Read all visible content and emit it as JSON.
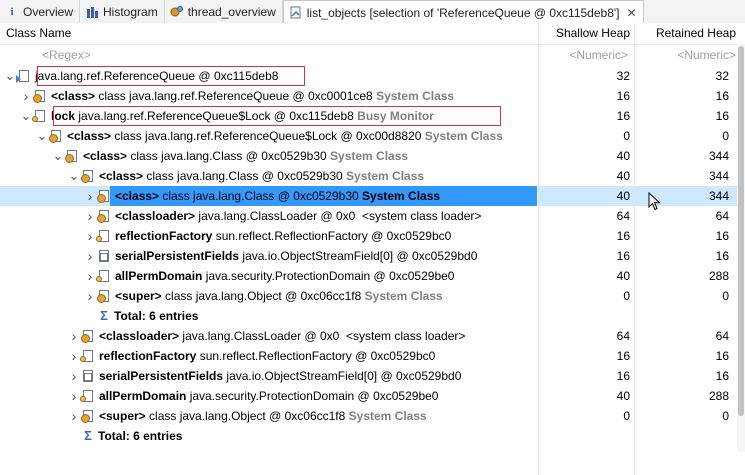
{
  "tabs": [
    {
      "label": "Overview",
      "icon": "info-icon"
    },
    {
      "label": "Histogram",
      "icon": "histogram-icon"
    },
    {
      "label": "thread_overview",
      "icon": "gears-icon"
    },
    {
      "label": "list_objects [selection of 'ReferenceQueue @ 0xc115deb8']",
      "icon": "list-objects-icon",
      "active": true
    }
  ],
  "columns": {
    "class_name": "Class Name",
    "shallow": "Shallow Heap",
    "retained": "Retained Heap"
  },
  "filters": {
    "class_name": "<Regex>",
    "shallow": "<Numeric>",
    "retained": "<Numeric>"
  },
  "rows": [
    {
      "arrow": "open",
      "icon": "object-page-icon",
      "parts": [
        [
          "",
          "java.lang.ref.ReferenceQueue @ 0xc115deb8"
        ]
      ],
      "shallow": "32",
      "retained": "32",
      "boxed": true
    },
    {
      "arrow": "closed",
      "icon": "class-gear-icon",
      "parts": [
        [
          "b",
          "<class>"
        ],
        [
          "",
          " class java.lang.ref.ReferenceQueue @ 0xc0001ce8 "
        ],
        [
          "gray",
          "System Class"
        ]
      ],
      "shallow": "16",
      "retained": "16"
    },
    {
      "arrow": "open",
      "icon": "field-page-icon",
      "parts": [
        [
          "b",
          "lock"
        ],
        [
          "",
          " java.lang.ref.ReferenceQueue$Lock @ 0xc115deb8 "
        ],
        [
          "gray",
          "Busy Monitor"
        ]
      ],
      "shallow": "16",
      "retained": "16",
      "boxed": true
    },
    {
      "arrow": "open",
      "icon": "class-gear-icon",
      "parts": [
        [
          "b",
          "<class>"
        ],
        [
          "",
          " class java.lang.ref.ReferenceQueue$Lock @ 0xc00d8820 "
        ],
        [
          "gray",
          "System Class"
        ]
      ],
      "shallow": "0",
      "retained": "0"
    },
    {
      "arrow": "open",
      "icon": "class-gear-icon",
      "parts": [
        [
          "b",
          "<class>"
        ],
        [
          "",
          " class java.lang.Class @ 0xc0529b30 "
        ],
        [
          "gray",
          "System Class"
        ]
      ],
      "shallow": "40",
      "retained": "344"
    },
    {
      "arrow": "open",
      "icon": "class-gear-icon",
      "parts": [
        [
          "b",
          "<class>"
        ],
        [
          "",
          " class java.lang.Class @ 0xc0529b30 "
        ],
        [
          "gray",
          "System Class"
        ]
      ],
      "shallow": "40",
      "retained": "344"
    },
    {
      "arrow": "closed",
      "icon": "class-gear-icon",
      "parts": [
        [
          "b",
          "<class>"
        ],
        [
          "",
          " class java.lang.Class @ 0xc0529b30 "
        ],
        [
          "b",
          "System Class"
        ]
      ],
      "shallow": "40",
      "retained": "344",
      "selected": true
    },
    {
      "arrow": "closed",
      "icon": "class-gear-icon",
      "parts": [
        [
          "b",
          "<classloader>"
        ],
        [
          "",
          " java.lang.ClassLoader @ 0x0  <system class loader>"
        ]
      ],
      "shallow": "64",
      "retained": "64"
    },
    {
      "arrow": "closed",
      "icon": "field-page-icon",
      "parts": [
        [
          "b",
          "reflectionFactory"
        ],
        [
          "",
          " sun.reflect.ReflectionFactory @ 0xc0529bc0"
        ]
      ],
      "shallow": "16",
      "retained": "16"
    },
    {
      "arrow": "closed",
      "icon": "array-page-icon",
      "parts": [
        [
          "b",
          "serialPersistentFields"
        ],
        [
          "",
          " java.io.ObjectStreamField[0] @ 0xc0529bd0"
        ]
      ],
      "shallow": "16",
      "retained": "16"
    },
    {
      "arrow": "closed",
      "icon": "field-page-icon",
      "parts": [
        [
          "b",
          "allPermDomain"
        ],
        [
          "",
          " java.security.ProtectionDomain @ 0xc0529be0"
        ]
      ],
      "shallow": "40",
      "retained": "288"
    },
    {
      "arrow": "closed",
      "icon": "class-gear-icon",
      "parts": [
        [
          "b",
          "<super>"
        ],
        [
          "",
          " class java.lang.Object @ 0xc06cc1f8 "
        ],
        [
          "gray",
          "System Class"
        ]
      ],
      "shallow": "0",
      "retained": "0"
    },
    {
      "arrow": "none",
      "icon": "sigma-icon",
      "parts": [
        [
          "b",
          "Total: 6 entries"
        ]
      ],
      "shallow": "",
      "retained": ""
    },
    {
      "arrow": "closed",
      "icon": "class-gear-icon",
      "parts": [
        [
          "b",
          "<classloader>"
        ],
        [
          "",
          " java.lang.ClassLoader @ 0x0  <system class loader>"
        ]
      ],
      "shallow": "64",
      "retained": "64"
    },
    {
      "arrow": "closed",
      "icon": "field-page-icon",
      "parts": [
        [
          "b",
          "reflectionFactory"
        ],
        [
          "",
          " sun.reflect.ReflectionFactory @ 0xc0529bc0"
        ]
      ],
      "shallow": "16",
      "retained": "16"
    },
    {
      "arrow": "closed",
      "icon": "array-page-icon",
      "parts": [
        [
          "b",
          "serialPersistentFields"
        ],
        [
          "",
          " java.io.ObjectStreamField[0] @ 0xc0529bd0"
        ]
      ],
      "shallow": "16",
      "retained": "16"
    },
    {
      "arrow": "closed",
      "icon": "field-page-icon",
      "parts": [
        [
          "b",
          "allPermDomain"
        ],
        [
          "",
          " java.security.ProtectionDomain @ 0xc0529be0"
        ]
      ],
      "shallow": "40",
      "retained": "288"
    },
    {
      "arrow": "closed",
      "icon": "class-gear-icon",
      "parts": [
        [
          "b",
          "<super>"
        ],
        [
          "",
          " class java.lang.Object @ 0xc06cc1f8 "
        ],
        [
          "gray",
          "System Class"
        ]
      ],
      "shallow": "0",
      "retained": "0"
    },
    {
      "arrow": "none",
      "icon": "sigma-icon",
      "parts": [
        [
          "b",
          "Total: 6 entries"
        ]
      ],
      "shallow": "",
      "retained": ""
    }
  ],
  "colors": {
    "selection": "#3399ff",
    "highlight_box": "#d9333f",
    "system_class_text": "#808080"
  }
}
